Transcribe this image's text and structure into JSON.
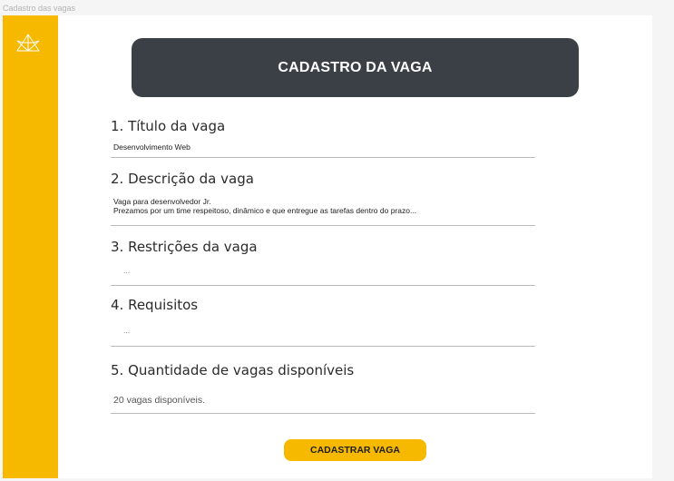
{
  "frame": {
    "label": "Cadastro das vagas"
  },
  "sidebar": {
    "logo_icon": "origami-bird-logo-icon",
    "color": "#f7b800"
  },
  "header": {
    "title": "CADASTRO DA VAGA",
    "bg_color": "#3b3f46"
  },
  "form": {
    "fields": [
      {
        "label": "1. Título da vaga",
        "value": "Desenvolvimento Web"
      },
      {
        "label": "2. Descrição da vaga",
        "value": "Vaga para desenvolvedor Jr.\nPrezamos por um time respeitoso, dinâmico e que entregue as tarefas dentro do prazo..."
      },
      {
        "label": "3. Restrições da vaga",
        "value": "..."
      },
      {
        "label": "4. Requisitos",
        "value": "..."
      },
      {
        "label": "5. Quantidade de vagas disponíveis",
        "value": "20 vagas disponíveis."
      }
    ],
    "submit_label": "CADASTRAR VAGA",
    "accent_color": "#f7b800"
  }
}
